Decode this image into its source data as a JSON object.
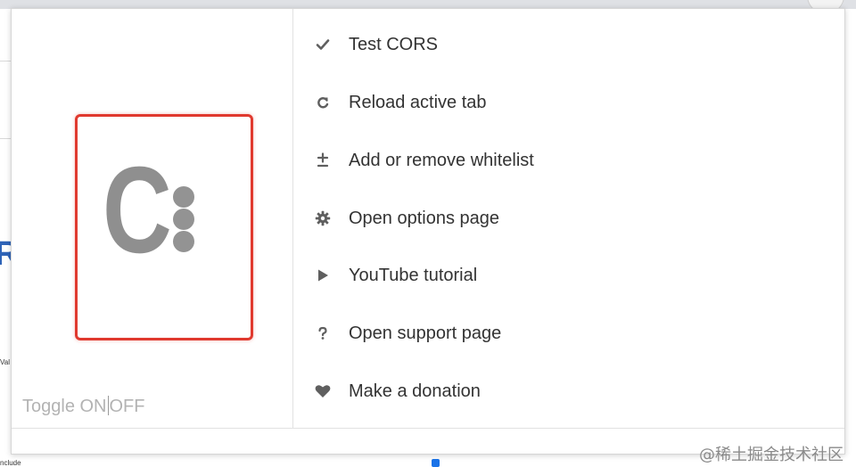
{
  "popup": {
    "toggle": {
      "on_text": "Toggle ON",
      "off_text": "OFF"
    },
    "logo": {
      "letter": "C"
    },
    "menu_items": [
      {
        "label": "Test CORS",
        "icon": "check-icon"
      },
      {
        "label": "Reload active tab",
        "icon": "reload-icon"
      },
      {
        "label": "Add or remove whitelist",
        "icon": "plus-minus-icon"
      },
      {
        "label": "Open options page",
        "icon": "gear-icon"
      },
      {
        "label": "YouTube tutorial",
        "icon": "play-icon"
      },
      {
        "label": "Open support page",
        "icon": "question-icon"
      },
      {
        "label": "Make a donation",
        "icon": "heart-icon"
      }
    ]
  },
  "background": {
    "fragment_left_letter": "R",
    "fragment_label_1": "Val",
    "fragment_label_2": "nclude"
  },
  "watermark": "@稀土掘金技术社区",
  "colors": {
    "highlight_border": "#e0392e",
    "logo_gray": "#8f8f8f",
    "icon_gray": "#5f5f5f",
    "text": "#333333"
  }
}
